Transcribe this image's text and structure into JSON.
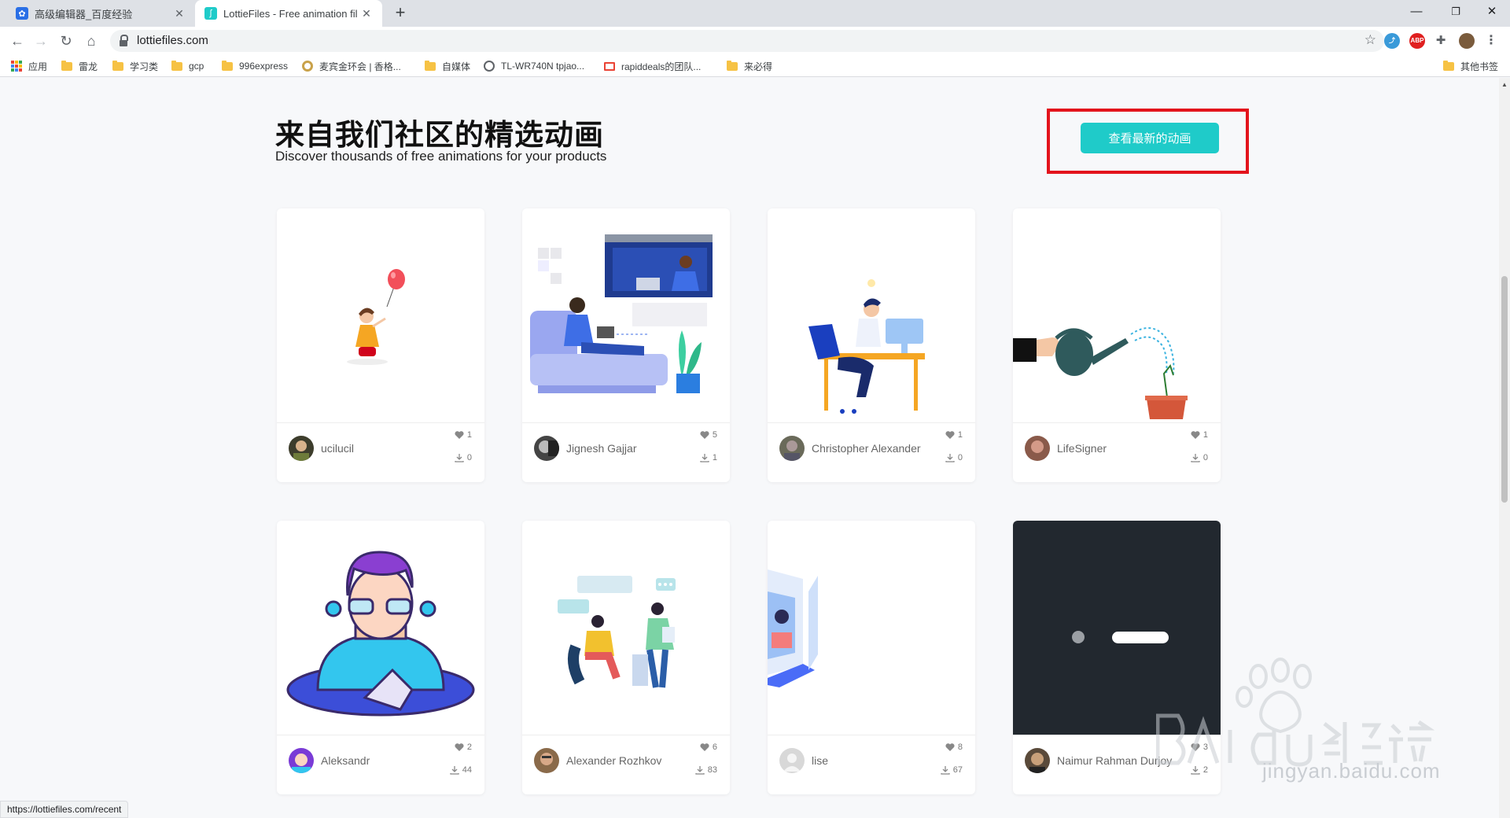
{
  "browser": {
    "tabs": [
      {
        "title": "高级编辑器_百度经验",
        "favicon": "baidu-paw-icon",
        "active": false
      },
      {
        "title": "LottieFiles - Free animation fil",
        "favicon": "lottiefiles-icon",
        "active": true
      }
    ],
    "new_tab": "+",
    "window_controls": {
      "minimize": "—",
      "restore": "❐",
      "close": "✕"
    },
    "url": "lottiefiles.com",
    "bookmarks": [
      {
        "label": "应用",
        "icon": "apps-grid-icon"
      },
      {
        "label": "雷龙",
        "icon": "folder-icon"
      },
      {
        "label": "学习类",
        "icon": "folder-icon"
      },
      {
        "label": "gcp",
        "icon": "folder-icon"
      },
      {
        "label": "996express",
        "icon": "folder-icon"
      },
      {
        "label": "麦宾金环会 | 香格...",
        "icon": "ring-icon"
      },
      {
        "label": "自媒体",
        "icon": "folder-icon"
      },
      {
        "label": "TL-WR740N tpjao...",
        "icon": "globe-icon"
      },
      {
        "label": "rapiddeals的团队...",
        "icon": "gmail-icon"
      },
      {
        "label": "来必得",
        "icon": "folder-icon"
      }
    ],
    "other_bookmarks": "其他书签",
    "status_url": "https://lottiefiles.com/recent"
  },
  "section": {
    "title": "来自我们社区的精选动画",
    "subtitle": "Discover thousands of free animations for your products",
    "cta_label": "查看最新的动画"
  },
  "cards": [
    {
      "author": "ucilucil",
      "likes": "1",
      "downloads": "0"
    },
    {
      "author": "Jignesh Gajjar",
      "likes": "5",
      "downloads": "1"
    },
    {
      "author": "Christopher Alexander",
      "likes": "1",
      "downloads": "0"
    },
    {
      "author": "LifeSigner",
      "likes": "1",
      "downloads": "0"
    },
    {
      "author": "Aleksandr",
      "likes": "2",
      "downloads": "44"
    },
    {
      "author": "Alexander Rozhkov",
      "likes": "6",
      "downloads": "83"
    },
    {
      "author": "lise",
      "likes": "8",
      "downloads": "67"
    },
    {
      "author": "Naimur Rahman Durjoy",
      "likes": "3",
      "downloads": "2"
    }
  ],
  "watermark": {
    "logo": "Bai du 经验",
    "url": "jingyan.baidu.com"
  },
  "colors": {
    "accent": "#1fcbc9",
    "highlight_box": "#e3141c"
  }
}
